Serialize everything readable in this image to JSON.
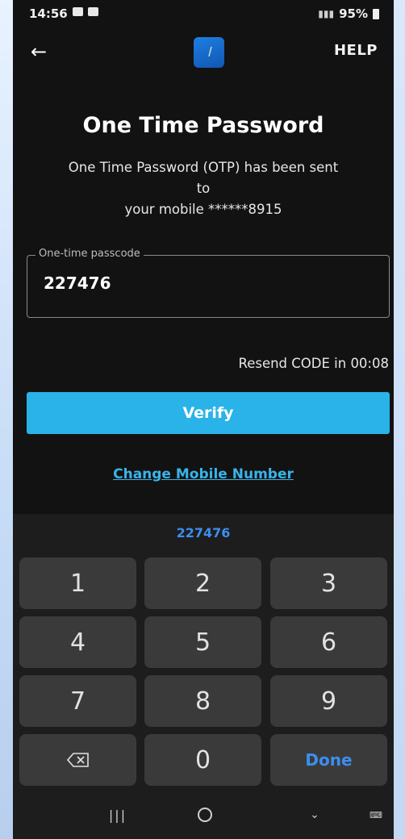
{
  "status_bar": {
    "time": "14:56",
    "battery": "95%"
  },
  "app_bar": {
    "back_icon": "arrow-left-icon",
    "help_label": "HELP"
  },
  "screen": {
    "title": "One Time Password",
    "subtitle_line1": "One Time Password (OTP) has been sent",
    "subtitle_line2": "to",
    "subtitle_line3": "your mobile ******8915"
  },
  "otp_field": {
    "label": "One-time passcode",
    "value": "227476"
  },
  "resend_text": "Resend CODE in 00:08",
  "verify_label": "Verify",
  "change_mobile_label": "Change Mobile Number",
  "keyboard": {
    "suggestion": "227476",
    "keys": [
      "1",
      "2",
      "3",
      "4",
      "5",
      "6",
      "7",
      "8",
      "9",
      "",
      "0",
      "Done"
    ]
  },
  "colors": {
    "accent": "#29b3e8",
    "link": "#39b4ea",
    "keyboard_accent": "#3b8ef0",
    "background": "#121212"
  }
}
